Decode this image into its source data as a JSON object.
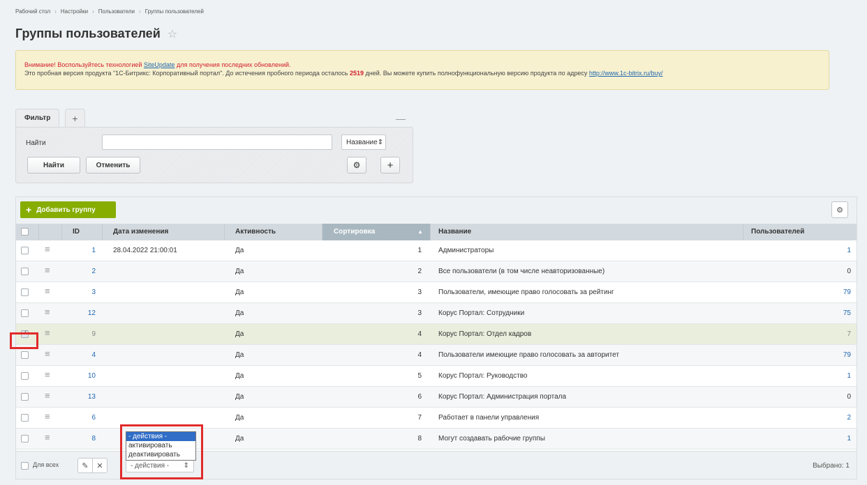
{
  "breadcrumb": [
    "Рабочий стол",
    "Настройки",
    "Пользователи",
    "Группы пользователей"
  ],
  "breadcrumb_sep": "›",
  "page_title": "Группы пользователей",
  "star_icon": "☆",
  "notice": {
    "line1_before": "Внимание! Воспользуйтесь технологией ",
    "line1_link": "SiteUpdate",
    "line1_after": " для получения последних обновлений.",
    "line2_before": "Это пробная версия продукта \"1С-Битрикс: Корпоративный портал\". До истечения пробного периода осталось ",
    "days": "2519",
    "line2_after": " дней. Вы можете купить полнофункциональную версию продукта по адресу ",
    "line2_link": "http://www.1c-bitrix.ru/buy/"
  },
  "filter": {
    "tab_label": "Фильтр",
    "add_tab": "+",
    "collapse": "—",
    "find_label": "Найти",
    "find_value": "",
    "field_select": "Название",
    "select_arrow": "⇕",
    "find_button": "Найти",
    "cancel_button": "Отменить",
    "gear": "⚙",
    "plus": "+"
  },
  "toolbar": {
    "add_plus": "+",
    "add_group": "Добавить группу",
    "gear": "⚙"
  },
  "columns": {
    "id": "ID",
    "date": "Дата изменения",
    "active": "Активность",
    "sort": "Сортировка",
    "sort_arrow": "▲",
    "name": "Название",
    "users": "Пользователей"
  },
  "rows": [
    {
      "id": "1",
      "date": "28.04.2022 21:00:01",
      "active": "Да",
      "sort": "1",
      "name": "Администраторы",
      "users": "1"
    },
    {
      "id": "2",
      "date": "",
      "active": "Да",
      "sort": "2",
      "name": "Все пользователи (в том числе неавторизованные)",
      "users": "0"
    },
    {
      "id": "3",
      "date": "",
      "active": "Да",
      "sort": "3",
      "name": "Пользователи, имеющие право голосовать за рейтинг",
      "users": "79"
    },
    {
      "id": "12",
      "date": "",
      "active": "Да",
      "sort": "3",
      "name": "Корус Портал: Сотрудники",
      "users": "75"
    },
    {
      "id": "9",
      "date": "",
      "active": "Да",
      "sort": "4",
      "name": "Корус Портал: Отдел кадров",
      "users": "7",
      "checked": true
    },
    {
      "id": "4",
      "date": "",
      "active": "Да",
      "sort": "4",
      "name": "Пользователи имеющие право голосовать за авторитет",
      "users": "79"
    },
    {
      "id": "10",
      "date": "",
      "active": "Да",
      "sort": "5",
      "name": "Корус Портал: Руководство",
      "users": "1"
    },
    {
      "id": "13",
      "date": "",
      "active": "Да",
      "sort": "6",
      "name": "Корус Портал: Администрация портала",
      "users": "0"
    },
    {
      "id": "6",
      "date": "",
      "active": "Да",
      "sort": "7",
      "name": "Работает в панели управления",
      "users": "2"
    },
    {
      "id": "8",
      "date": "",
      "active": "Да",
      "sort": "8",
      "name": "Могут создавать рабочие группы",
      "users": "1"
    }
  ],
  "row_menu_icon": "≡",
  "footer": {
    "for_all": "Для всех",
    "edit_icon": "✎",
    "delete_icon": "✕",
    "actions_select": "- действия -",
    "select_arrow": "⇕",
    "selected_count": "Выбрано: 1"
  },
  "actions_dropdown": [
    "- действия -",
    "активировать",
    "деактивировать"
  ],
  "colors": {
    "accent_green": "#86ad00",
    "highlight_red": "#e12b2b",
    "link_blue": "#2067b0"
  }
}
